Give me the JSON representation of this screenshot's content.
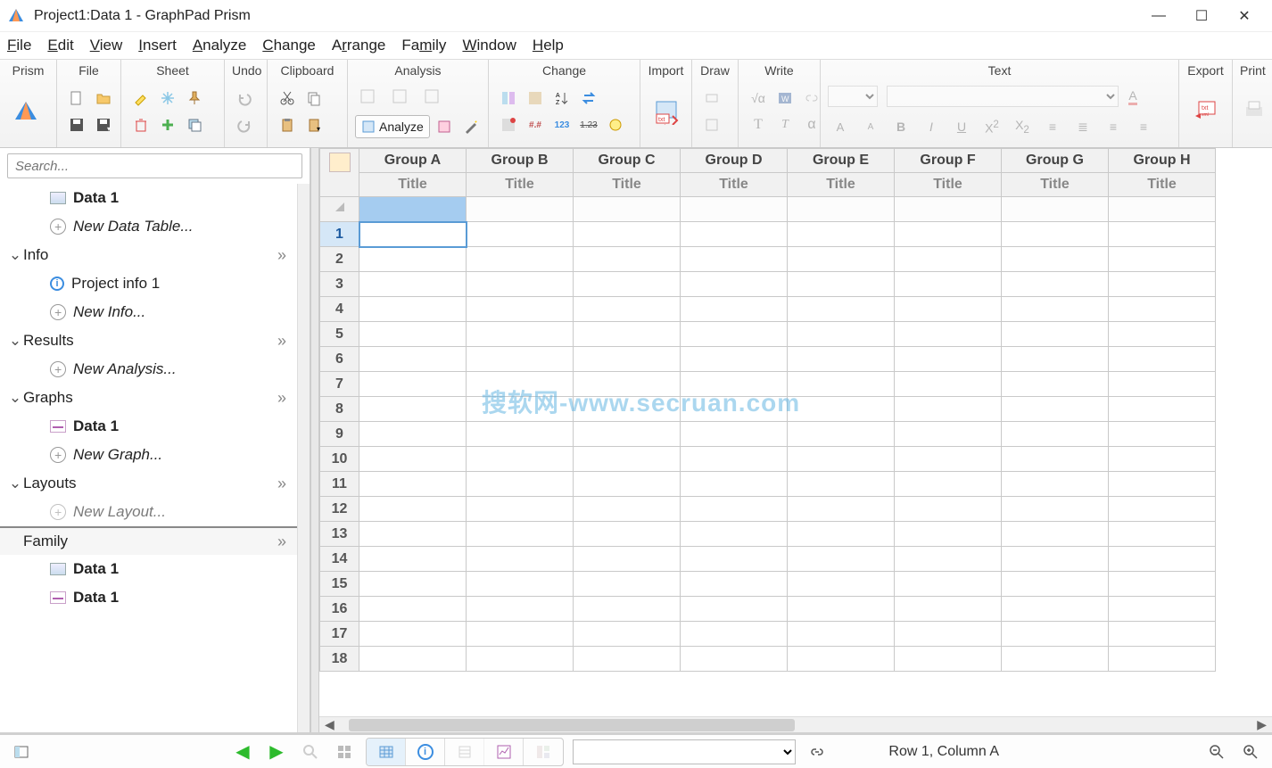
{
  "title": "Project1:Data 1 - GraphPad Prism",
  "menus": [
    "File",
    "Edit",
    "View",
    "Insert",
    "Analyze",
    "Change",
    "Arrange",
    "Family",
    "Window",
    "Help"
  ],
  "ribbon_groups": {
    "prism": "Prism",
    "file": "File",
    "sheet": "Sheet",
    "undo": "Undo",
    "clipboard": "Clipboard",
    "analysis": "Analysis",
    "change": "Change",
    "import": "Import",
    "draw": "Draw",
    "write": "Write",
    "text": "Text",
    "export": "Export",
    "print": "Print"
  },
  "analyze_label": "Analyze",
  "search_placeholder": "Search...",
  "nav": {
    "data1": "Data 1",
    "new_data": "New Data Table...",
    "info": "Info",
    "project_info": "Project info 1",
    "new_info": "New Info...",
    "results": "Results",
    "new_analysis": "New Analysis...",
    "graphs": "Graphs",
    "graph_data1": "Data 1",
    "new_graph": "New Graph...",
    "layouts": "Layouts",
    "new_layout": "New Layout...",
    "family": "Family",
    "family_data1": "Data 1",
    "family_graph1": "Data 1"
  },
  "columns": [
    "Group A",
    "Group B",
    "Group C",
    "Group D",
    "Group E",
    "Group F",
    "Group G",
    "Group H"
  ],
  "col_subtitle": "Title",
  "row_count": 18,
  "watermark": "搜软网-www.secruan.com",
  "status": "Row 1, Column A"
}
